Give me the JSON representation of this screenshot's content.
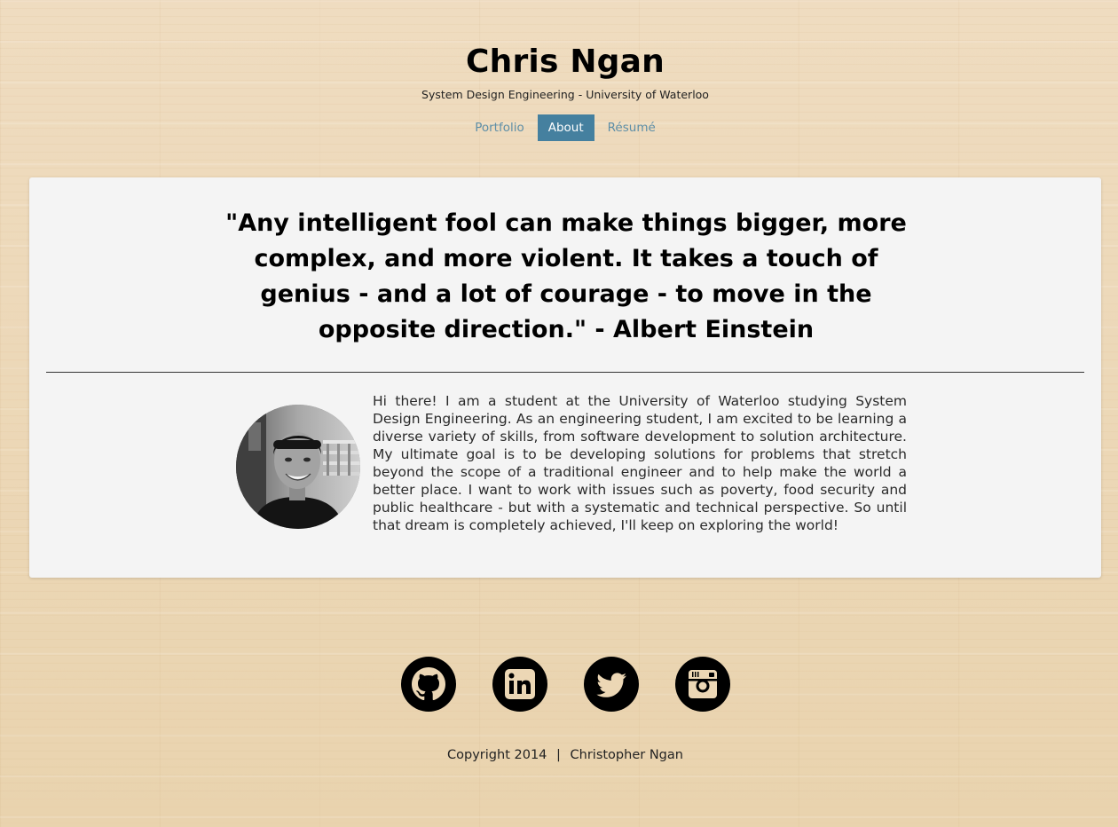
{
  "header": {
    "title": "Chris Ngan",
    "subtitle": "System Design Engineering - University of Waterloo"
  },
  "nav": {
    "items": [
      {
        "label": "Portfolio",
        "active": false
      },
      {
        "label": "About",
        "active": true
      },
      {
        "label": "Résumé",
        "active": false
      }
    ]
  },
  "about": {
    "quote": "\"Any intelligent fool can make things bigger, more complex, and more violent. It takes a touch of genius - and a lot of courage - to move in the opposite direction.\" - Albert Einstein",
    "bio": "Hi there! I am a student at the University of Waterloo studying System Design Engineering. As an engineering student, I am excited to be learning a diverse variety of skills, from software development to solution architecture. My ultimate goal is to be developing solutions for problems that stretch beyond the scope of a traditional engineer and to help make the world a better place. I want to work with issues such as poverty, food security and public healthcare - but with a systematic and technical perspective. So until that dream is completely achieved, I'll keep on exploring the world!"
  },
  "social": {
    "icons": [
      "github-icon",
      "linkedin-icon",
      "twitter-icon",
      "instagram-icon"
    ]
  },
  "footer": {
    "copyright": "Copyright 2014",
    "separator": "|",
    "name": "Christopher Ngan"
  },
  "colors": {
    "accent": "#45809f",
    "nav_link": "#5d8ea7",
    "card_bg": "#f4f4f4"
  }
}
